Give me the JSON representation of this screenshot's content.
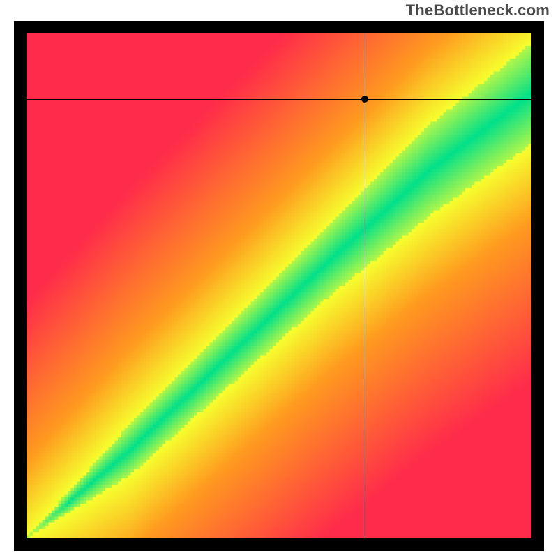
{
  "attribution": "TheBottleneck.com",
  "chart_data": {
    "type": "heatmap",
    "title": "",
    "xlabel": "",
    "ylabel": "",
    "xlim": [
      0,
      100
    ],
    "ylim": [
      0,
      100
    ],
    "axes_visible": false,
    "grid": false,
    "legend": "none",
    "color_scale": [
      {
        "value": 0.0,
        "meaning": "optimal-match",
        "color": "#00e08a"
      },
      {
        "value": 0.3,
        "meaning": "near-optimal",
        "color": "#f6ff2e"
      },
      {
        "value": 0.6,
        "meaning": "mismatch",
        "color": "#ff9a1f"
      },
      {
        "value": 1.0,
        "meaning": "severe-mismatch",
        "color": "#ff2b4a"
      }
    ],
    "diagonal_band": {
      "description": "green optimal band where x and y are balanced; band widens slightly toward the top-right",
      "approx_points_lower": [
        [
          0,
          0
        ],
        [
          20,
          12
        ],
        [
          40,
          30
        ],
        [
          60,
          48
        ],
        [
          80,
          64
        ],
        [
          100,
          78
        ]
      ],
      "approx_points_upper": [
        [
          0,
          0
        ],
        [
          20,
          22
        ],
        [
          40,
          42
        ],
        [
          60,
          62
        ],
        [
          80,
          82
        ],
        [
          100,
          98
        ]
      ]
    },
    "marker": {
      "x": 67,
      "y": 87,
      "note": "crosshair intersection point shown as black dot"
    },
    "crosshair": {
      "x": 67,
      "y": 87
    }
  },
  "colors": {
    "frame": "#000000",
    "attribution_text": "#4a4a4a"
  }
}
